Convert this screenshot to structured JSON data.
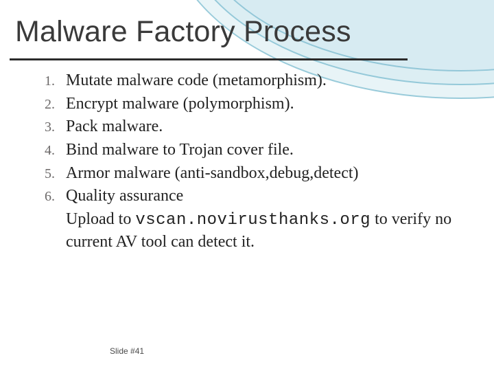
{
  "title": "Malware Factory Process",
  "items": [
    {
      "n": "1.",
      "t": "Mutate malware code (metamorphism)."
    },
    {
      "n": "2.",
      "t": "Encrypt malware (polymorphism)."
    },
    {
      "n": "3.",
      "t": "Pack malware."
    },
    {
      "n": "4.",
      "t": "Bind malware to Trojan cover file."
    },
    {
      "n": "5.",
      "t": "Armor malware (anti-sandbox,debug,detect)"
    },
    {
      "n": "6.",
      "t": "Quality assurance"
    }
  ],
  "detail_pre": "Upload to ",
  "detail_code": "vscan.novirusthanks.org",
  "detail_post": " to verify no current AV tool can detect it.",
  "footer": "Slide #41"
}
